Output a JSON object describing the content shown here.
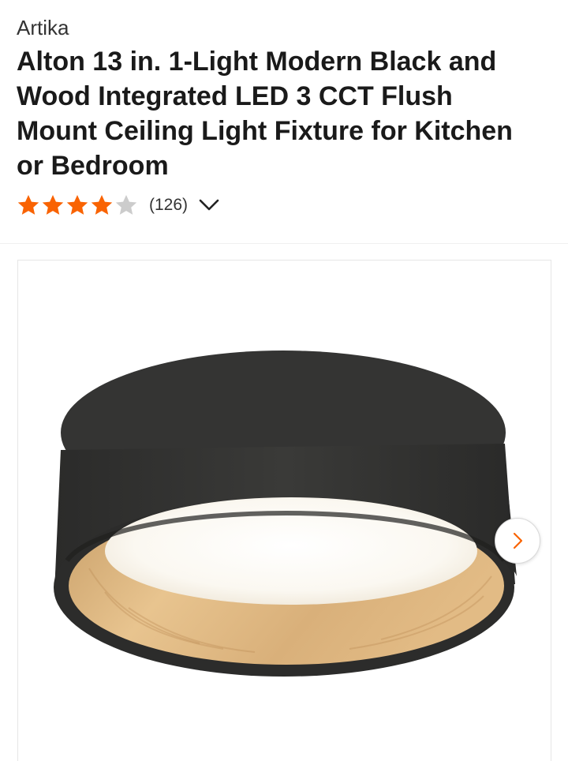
{
  "product": {
    "brand": "Artika",
    "title": "Alton 13 in. 1-Light Modern Black and Wood Integrated LED 3 CCT Flush Mount Ceiling Light Fixture for Kitchen or Bedroom",
    "rating": 4,
    "rating_max": 5,
    "review_count": "(126)"
  },
  "colors": {
    "star_filled": "#f96302",
    "star_empty": "#cccccc",
    "accent": "#f96302"
  },
  "icons": {
    "rating_expand": "chevron-down-icon",
    "gallery_next": "chevron-right-icon"
  }
}
